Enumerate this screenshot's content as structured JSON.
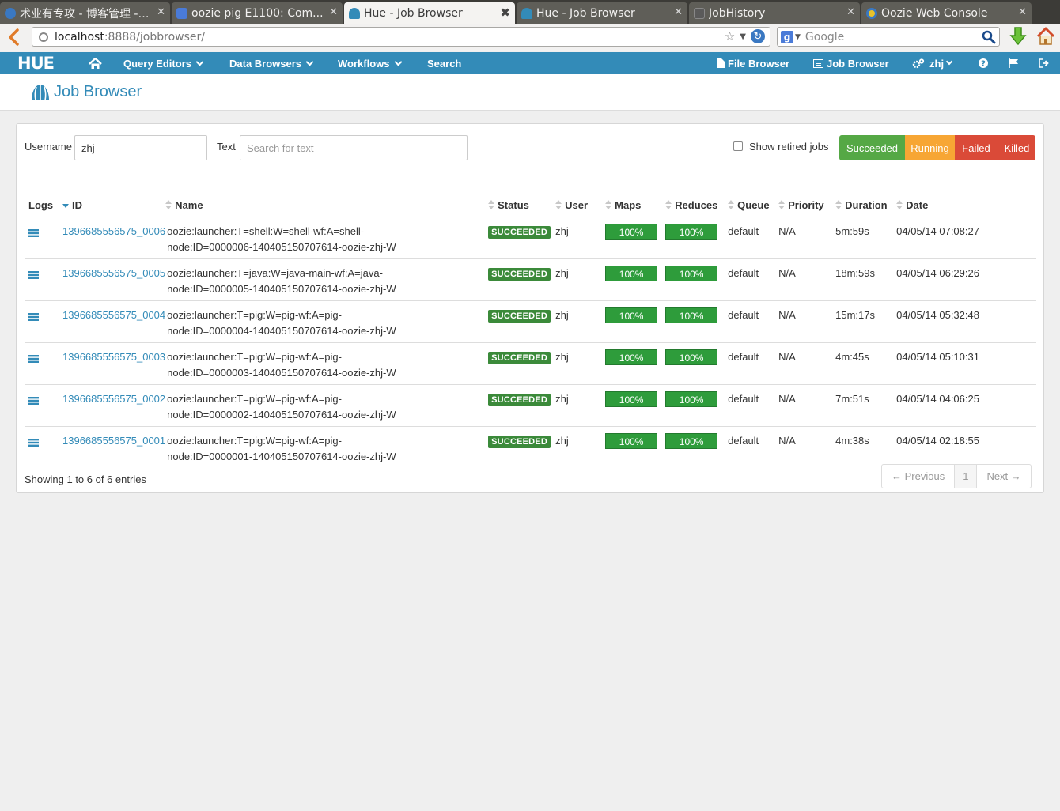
{
  "browser": {
    "tabs": [
      {
        "title": "术业有专攻 - 博客管理 - ...",
        "favicon_color": "#3a78c2",
        "active": false
      },
      {
        "title": "oozie pig E1100: Com...",
        "favicon_color": "#4a7bd8",
        "active": false
      },
      {
        "title": "Hue - Job Browser",
        "favicon_color": "#338bb8",
        "active": true
      },
      {
        "title": "Hue - Job Browser",
        "favicon_color": "#338bb8",
        "active": false
      },
      {
        "title": "JobHistory",
        "favicon_color": "#7a7a7a",
        "active": false
      },
      {
        "title": "Oozie Web Console",
        "favicon_color": "#e8c22a",
        "active": false
      }
    ],
    "url_host": "localhost",
    "url_path": ":8888/jobbrowser/",
    "search_placeholder": "Google",
    "search_engine_letter": "g"
  },
  "nav": {
    "logo": "HUE",
    "query_editors": "Query Editors",
    "data_browsers": "Data Browsers",
    "workflows": "Workflows",
    "search": "Search",
    "file_browser": "File Browser",
    "job_browser": "Job Browser",
    "user": "zhj"
  },
  "page": {
    "title": "Job Browser"
  },
  "filters": {
    "username_label": "Username",
    "username_value": "zhj",
    "text_label": "Text",
    "text_placeholder": "Search for text",
    "retired_label": "Show retired jobs",
    "succeeded": "Succeeded",
    "running": "Running",
    "failed": "Failed",
    "killed": "Killed"
  },
  "colors": {
    "succeeded": "#55a845",
    "running": "#f7a634",
    "failed": "#da4a38",
    "killed": "#da4a38"
  },
  "table": {
    "headers": {
      "logs": "Logs",
      "id": "ID",
      "name": "Name",
      "status": "Status",
      "user": "User",
      "maps": "Maps",
      "reduces": "Reduces",
      "queue": "Queue",
      "priority": "Priority",
      "duration": "Duration",
      "date": "Date"
    },
    "rows": [
      {
        "id": "1396685556575_0006",
        "name1": "oozie:launcher:T=shell:W=shell-wf:A=shell-",
        "name2": "node:ID=0000006-140405150707614-oozie-zhj-W",
        "status": "SUCCEEDED",
        "user": "zhj",
        "maps": "100%",
        "reduces": "100%",
        "queue": "default",
        "priority": "N/A",
        "duration": "5m:59s",
        "date": "04/05/14 07:08:27"
      },
      {
        "id": "1396685556575_0005",
        "name1": "oozie:launcher:T=java:W=java-main-wf:A=java-",
        "name2": "node:ID=0000005-140405150707614-oozie-zhj-W",
        "status": "SUCCEEDED",
        "user": "zhj",
        "maps": "100%",
        "reduces": "100%",
        "queue": "default",
        "priority": "N/A",
        "duration": "18m:59s",
        "date": "04/05/14 06:29:26"
      },
      {
        "id": "1396685556575_0004",
        "name1": "oozie:launcher:T=pig:W=pig-wf:A=pig-",
        "name2": "node:ID=0000004-140405150707614-oozie-zhj-W",
        "status": "SUCCEEDED",
        "user": "zhj",
        "maps": "100%",
        "reduces": "100%",
        "queue": "default",
        "priority": "N/A",
        "duration": "15m:17s",
        "date": "04/05/14 05:32:48"
      },
      {
        "id": "1396685556575_0003",
        "name1": "oozie:launcher:T=pig:W=pig-wf:A=pig-",
        "name2": "node:ID=0000003-140405150707614-oozie-zhj-W",
        "status": "SUCCEEDED",
        "user": "zhj",
        "maps": "100%",
        "reduces": "100%",
        "queue": "default",
        "priority": "N/A",
        "duration": "4m:45s",
        "date": "04/05/14 05:10:31"
      },
      {
        "id": "1396685556575_0002",
        "name1": "oozie:launcher:T=pig:W=pig-wf:A=pig-",
        "name2": "node:ID=0000002-140405150707614-oozie-zhj-W",
        "status": "SUCCEEDED",
        "user": "zhj",
        "maps": "100%",
        "reduces": "100%",
        "queue": "default",
        "priority": "N/A",
        "duration": "7m:51s",
        "date": "04/05/14 04:06:25"
      },
      {
        "id": "1396685556575_0001",
        "name1": "oozie:launcher:T=pig:W=pig-wf:A=pig-",
        "name2": "node:ID=0000001-140405150707614-oozie-zhj-W",
        "status": "SUCCEEDED",
        "user": "zhj",
        "maps": "100%",
        "reduces": "100%",
        "queue": "default",
        "priority": "N/A",
        "duration": "4m:38s",
        "date": "04/05/14 02:18:55"
      }
    ]
  },
  "footer": {
    "showing": "Showing 1 to 6 of 6 entries",
    "previous": "← Previous",
    "page": "1",
    "next": "Next →"
  }
}
